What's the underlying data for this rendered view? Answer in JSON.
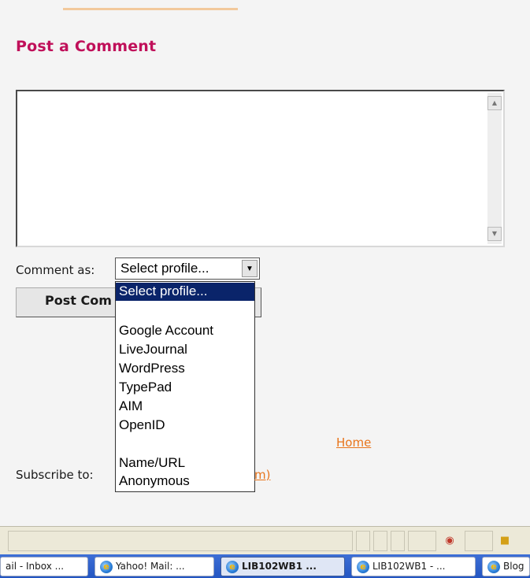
{
  "comment_section": {
    "title": "Post a Comment",
    "textarea_value": "",
    "comment_as_label": "Comment as:",
    "profile_select_value": "Select profile...",
    "post_button_label": "Post Com"
  },
  "profile_dropdown": {
    "options": [
      {
        "label": "Select profile...",
        "selected": true
      },
      {
        "label": "",
        "selected": false
      },
      {
        "label": "Google Account",
        "selected": false
      },
      {
        "label": "LiveJournal",
        "selected": false
      },
      {
        "label": "WordPress",
        "selected": false
      },
      {
        "label": "TypePad",
        "selected": false
      },
      {
        "label": "AIM",
        "selected": false
      },
      {
        "label": "OpenID",
        "selected": false
      },
      {
        "label": "",
        "selected": false
      },
      {
        "label": "Name/URL",
        "selected": false
      },
      {
        "label": "Anonymous",
        "selected": false
      }
    ]
  },
  "footer": {
    "home_link": "Home",
    "subscribe_label": "Subscribe to:",
    "subscribe_link_tail": "m)"
  },
  "taskbar": {
    "items": [
      {
        "label": "ail - Inbox ...",
        "icon": "",
        "active": false
      },
      {
        "label": "Yahoo! Mail: ...",
        "icon": "ie-icon",
        "active": false
      },
      {
        "label": "LIB102WB1 ...",
        "icon": "ie-icon",
        "active": true
      },
      {
        "label": "LIB102WB1 - ...",
        "icon": "ie-icon",
        "active": false
      },
      {
        "label": "Blog",
        "icon": "ie-icon",
        "active": false
      }
    ]
  },
  "colors": {
    "title_accent": "#c0105a",
    "link_orange": "#e8741a",
    "selection_blue": "#0a246a",
    "taskbar_blue": "#2456c2"
  }
}
